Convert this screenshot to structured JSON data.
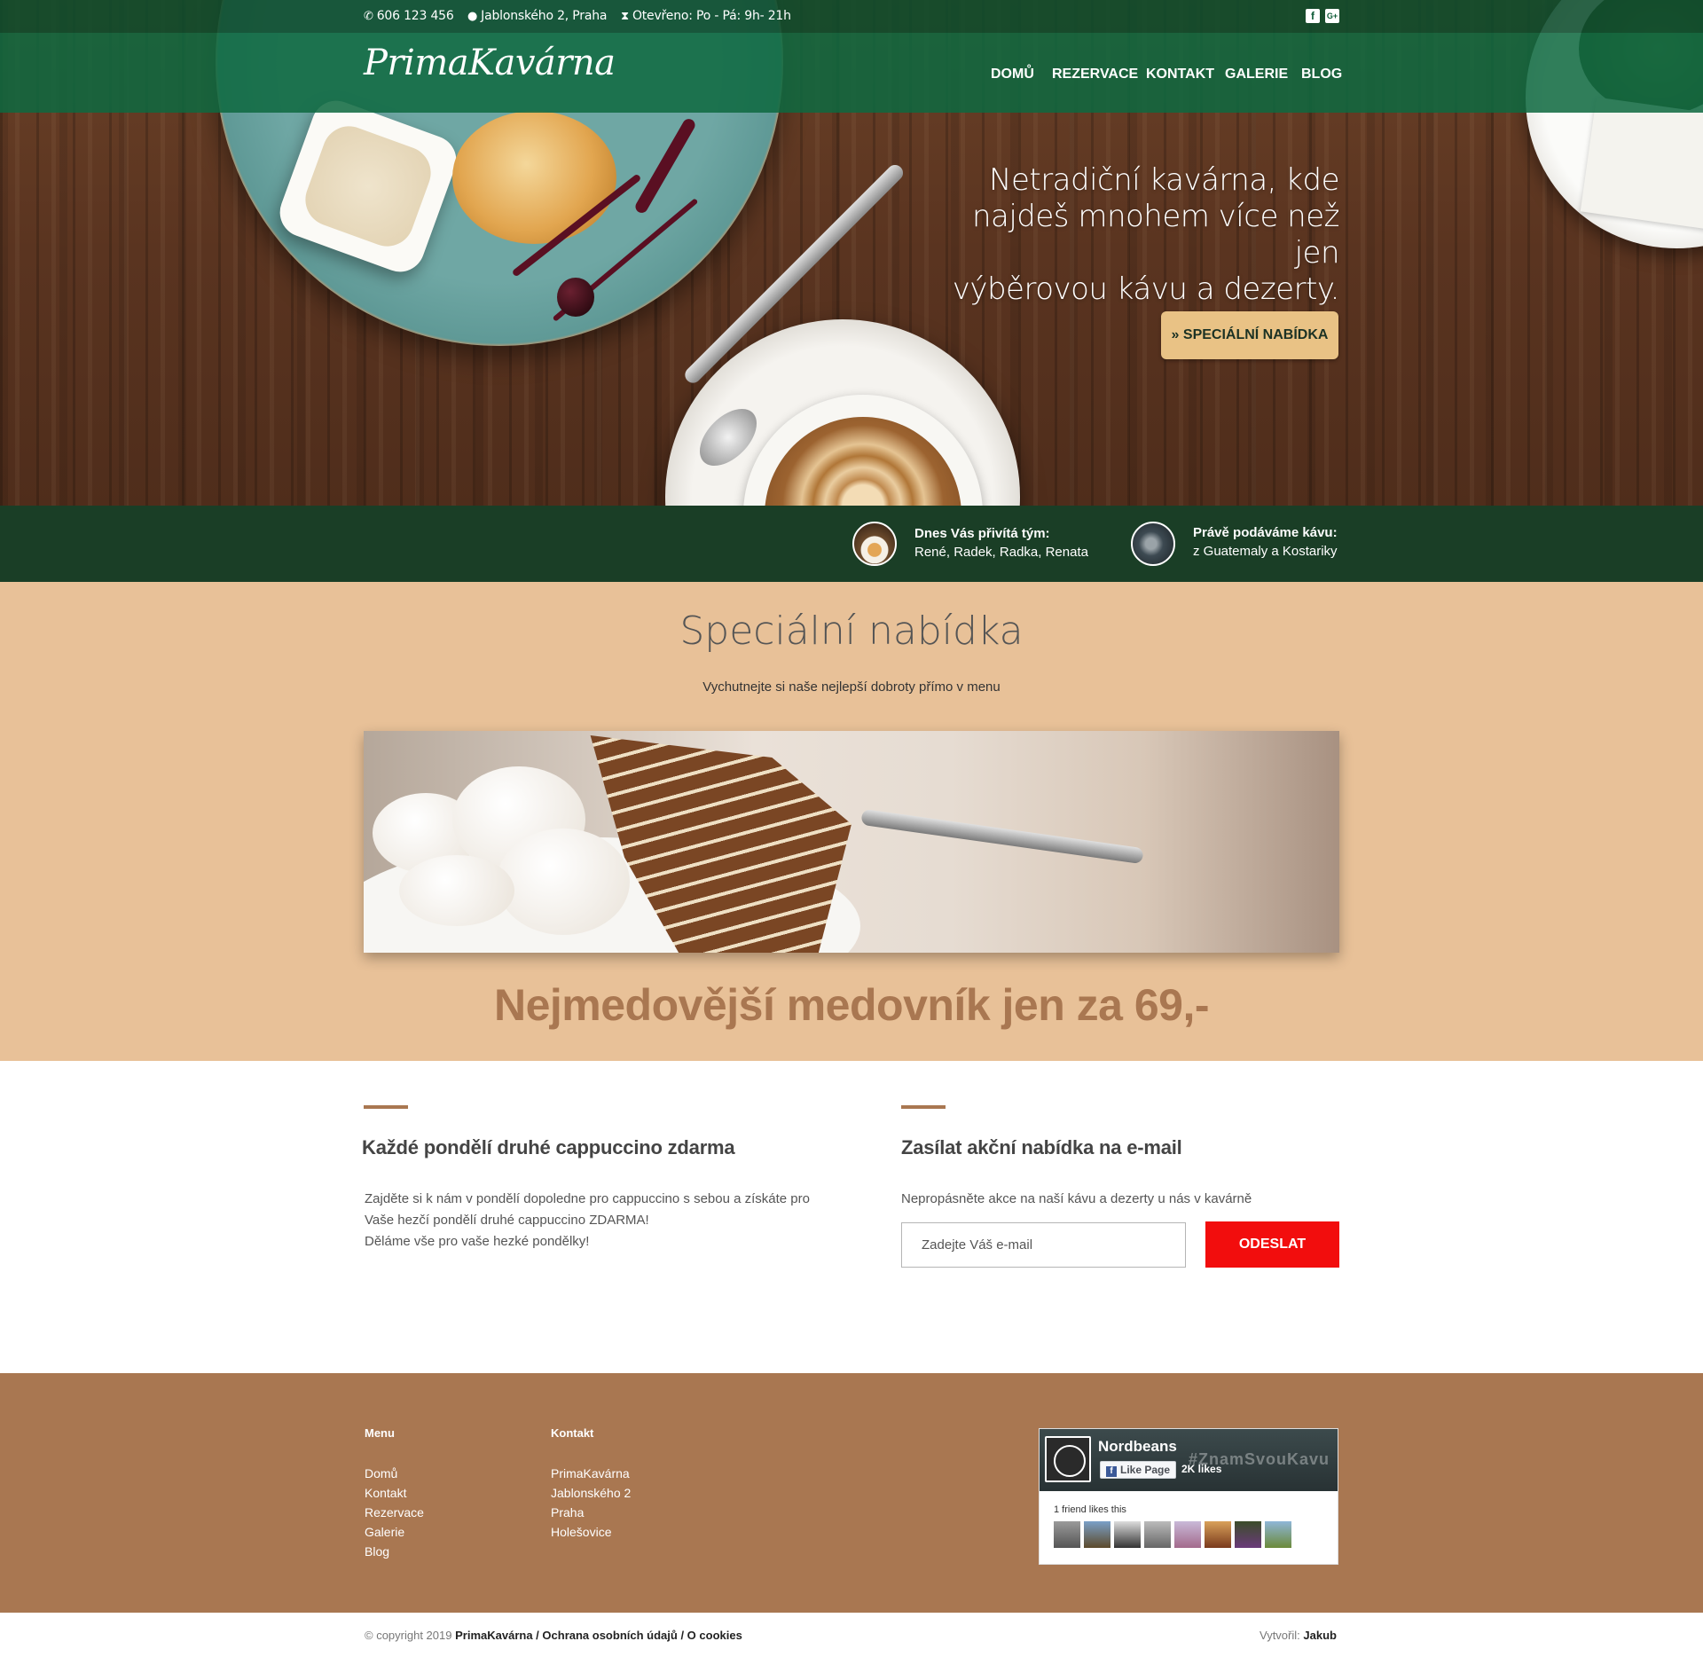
{
  "topbar": {
    "phone": "606 123 456",
    "address": "Jablonského 2, Praha",
    "hours": "Otevřeno: Po - Pá: 9h- 21h",
    "social": [
      {
        "icon": "facebook-icon",
        "label": "f"
      },
      {
        "icon": "google-plus-icon",
        "label": "G+"
      }
    ]
  },
  "brand": {
    "logo": "PrimaKavárna"
  },
  "nav": {
    "items": [
      "DOMŮ",
      "REZERVACE",
      "KONTAKT",
      "GALERIE",
      "BLOG"
    ]
  },
  "hero": {
    "headline_lines": [
      "Netradiční kavárna, kde",
      "najdeš mnohem více než jen",
      "výběrovou kávu a dezerty."
    ],
    "cta_label": "» SPECIÁLNÍ NABÍDKA"
  },
  "status": {
    "team_title": "Dnes Vás přivítá tým:",
    "team_value": "René, Radek, Radka, Renata",
    "coffee_title": "Právě podáváme kávu:",
    "coffee_value": "z Guatemaly a Kostariky"
  },
  "offer": {
    "title": "Speciální nabídka",
    "subtitle": "Vychutnejte si naše nejlepší dobroty přímo v menu",
    "price_line": "Nejmedovější medovník jen za 69,-"
  },
  "promo": {
    "title": "Každé pondělí druhé cappuccino zdarma",
    "lines": [
      "Zajděte si k nám v pondělí dopoledne pro cappuccino s sebou a získáte pro",
      "Vaše hezčí pondělí druhé cappuccino ZDARMA!",
      "Děláme vše pro vaše hezké pondělky!"
    ]
  },
  "newsletter": {
    "title": "Zasílat akční nabídka na e-mail",
    "text": "Nepropásněte akce na naší kávu a dezerty u nás v kavárně",
    "placeholder": "Zadejte Váš e-mail",
    "button": "ODESLAT"
  },
  "footer": {
    "menu_title": "Menu",
    "menu_items": [
      "Domů",
      "Kontakt",
      "Rezervace",
      "Galerie",
      "Blog"
    ],
    "contact_title": "Kontakt",
    "contact_items": [
      "PrimaKavárna",
      "Jablonského 2",
      "Praha",
      "Holešovice"
    ],
    "fb": {
      "page_name": "Nordbeans",
      "like_label": "Like Page",
      "likes": "2K likes",
      "hashtag": "#ZnamSvouKavu",
      "friends_text": "1 friend likes this"
    }
  },
  "copyright": {
    "prefix": "© copyright 2019",
    "brand": "PrimaKavárna",
    "sep1": " / ",
    "privacy": "Ochrana osobních údajů",
    "sep2": " / ",
    "cookies": "O cookies",
    "author_label": "Vytvořil:",
    "author": "Jakub"
  },
  "colors": {
    "nav_green": "#0e6940",
    "status_green": "#1a3e26",
    "offer_bg": "#e8c198",
    "accent_brown": "#a97751",
    "cta_gold": "#e9c285",
    "submit_red": "#f20d0d"
  }
}
